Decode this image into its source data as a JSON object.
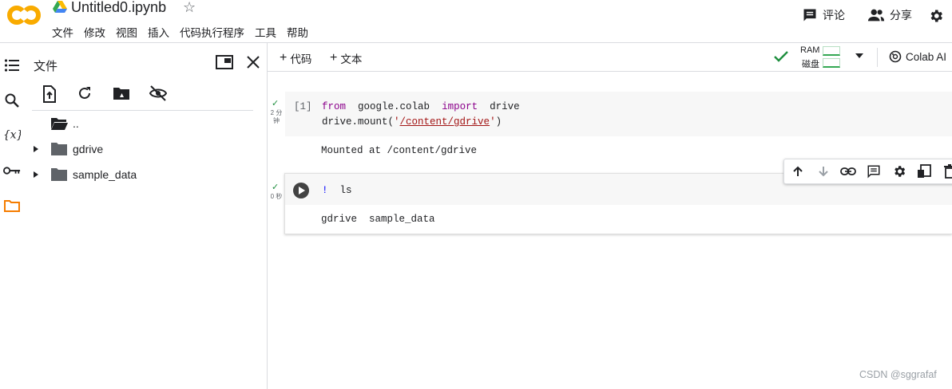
{
  "header": {
    "title": "Untitled0.ipynb",
    "star_glyph": "☆",
    "menu": [
      "文件",
      "修改",
      "视图",
      "插入",
      "代码执行程序",
      "工具",
      "帮助"
    ],
    "comment_label": "评论",
    "share_label": "分享"
  },
  "file_panel": {
    "title": "文件",
    "tree": [
      {
        "label": "..",
        "expandable": false
      },
      {
        "label": "gdrive",
        "expandable": true
      },
      {
        "label": "sample_data",
        "expandable": true
      }
    ]
  },
  "toolbar": {
    "add_code_label": "代码",
    "add_text_label": "文本",
    "ram_label": "RAM",
    "disk_label": "磁盘",
    "colab_ai_label": "Colab AI"
  },
  "cells": [
    {
      "exec_count": "[1]",
      "status_time": "2 分钟",
      "code_line1": {
        "kw1": "from",
        "mod": "google.colab",
        "kw2": "import",
        "name": "drive"
      },
      "code_line2": {
        "prefix": "drive.mount(",
        "quote_open": "'",
        "path": "/content/gdrive",
        "quote_close": "'",
        "suffix": ")"
      },
      "output": "Mounted at /content/gdrive"
    },
    {
      "status_time": "0 秒",
      "code_bang": "!",
      "code_cmd": "ls",
      "output": "gdrive  sample_data"
    }
  ],
  "watermark": "CSDN @sggrafaf",
  "colors": {
    "accent_orange": "#f9ab00",
    "check_green": "#1e8e3e",
    "keyword_purple": "#8b008b",
    "string_red": "#a31515"
  }
}
